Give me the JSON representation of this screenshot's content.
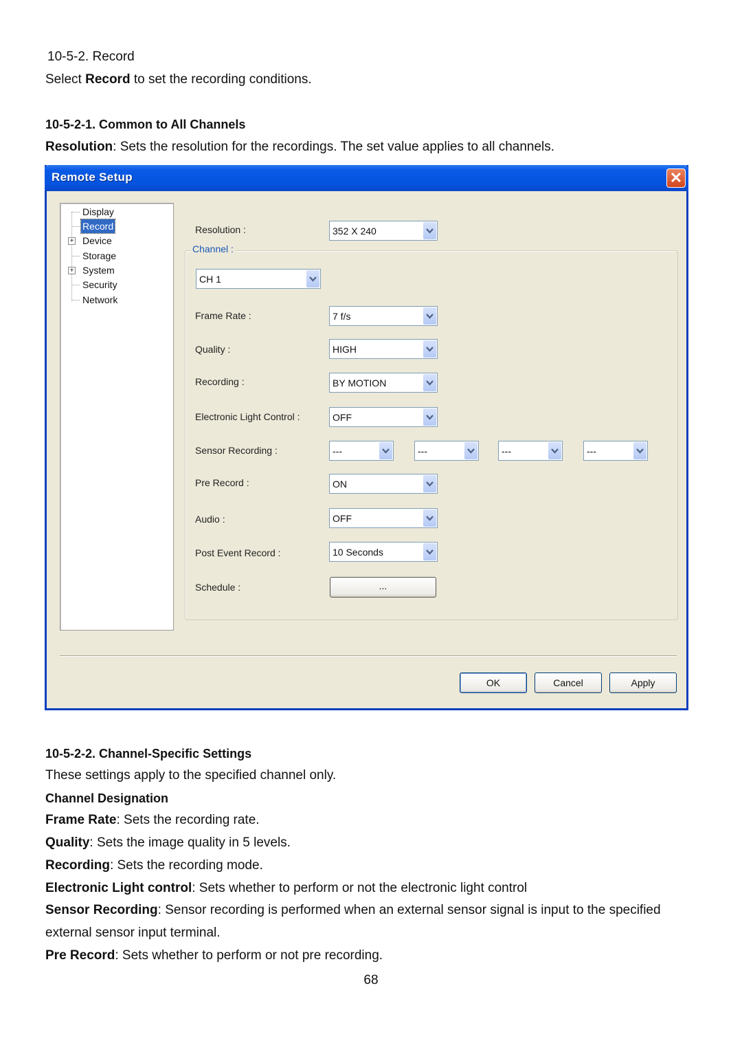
{
  "doc": {
    "heading": "10-5-2. Record",
    "intro": {
      "pre": "Select ",
      "bold": "Record",
      "post": " to set the recording conditions."
    },
    "section1_title": "10-5-2-1. Common to All Channels",
    "resolution_desc": {
      "bold": "Resolution",
      "text": ": Sets the resolution for the recordings. The set value applies to all channels."
    },
    "section2_title": "10-5-2-2. Channel-Specific Settings",
    "section2_intro": "These settings apply to the specified channel only.",
    "channel_designation": "Channel Designation",
    "definitions": [
      {
        "bold": "Frame Rate",
        "text": ": Sets the recording rate."
      },
      {
        "bold": "Quality",
        "text": ": Sets the image quality in 5 levels."
      },
      {
        "bold": "Recording",
        "text": ": Sets the recording mode."
      },
      {
        "bold": "Electronic Light control",
        "text": ": Sets whether to perform or not the electronic light control"
      },
      {
        "bold": "Sensor Recording",
        "text": ": Sensor recording is performed when an external sensor signal is input to the specified"
      },
      {
        "bold": "",
        "text": "external sensor input terminal."
      },
      {
        "bold": "Pre Record",
        "text": ": Sets whether to perform or not pre recording."
      }
    ],
    "page_number": "68"
  },
  "dialog": {
    "title": "Remote Setup",
    "close_glyph": "✕",
    "tree": [
      {
        "label": "Display",
        "expandable": false,
        "selected": false
      },
      {
        "label": "Record",
        "expandable": false,
        "selected": true
      },
      {
        "label": "Device",
        "expandable": true,
        "selected": false
      },
      {
        "label": "Storage",
        "expandable": false,
        "selected": false
      },
      {
        "label": "System",
        "expandable": true,
        "selected": false
      },
      {
        "label": "Security",
        "expandable": false,
        "selected": false
      },
      {
        "label": "Network",
        "expandable": false,
        "selected": false
      }
    ],
    "expander_glyph": "+",
    "resolution": {
      "label": "Resolution :",
      "value": "352 X 240"
    },
    "channel_group_label": "Channel :",
    "channel_select": "CH 1",
    "fields": {
      "frame_rate": {
        "label": "Frame Rate :",
        "value": "7 f/s"
      },
      "quality": {
        "label": "Quality :",
        "value": "HIGH"
      },
      "recording": {
        "label": "Recording :",
        "value": "BY MOTION"
      },
      "elc": {
        "label": "Electronic Light Control :",
        "value": "OFF"
      },
      "sensor": {
        "label": "Sensor Recording :",
        "values": [
          "---",
          "---",
          "---",
          "---"
        ]
      },
      "pre_record": {
        "label": "Pre Record :",
        "value": "ON"
      },
      "audio": {
        "label": "Audio :",
        "value": "OFF"
      },
      "post_event": {
        "label": "Post Event Record :",
        "value": "10 Seconds"
      },
      "schedule": {
        "label": "Schedule :",
        "button": "..."
      }
    },
    "buttons": {
      "ok": "OK",
      "cancel": "Cancel",
      "apply": "Apply"
    }
  }
}
